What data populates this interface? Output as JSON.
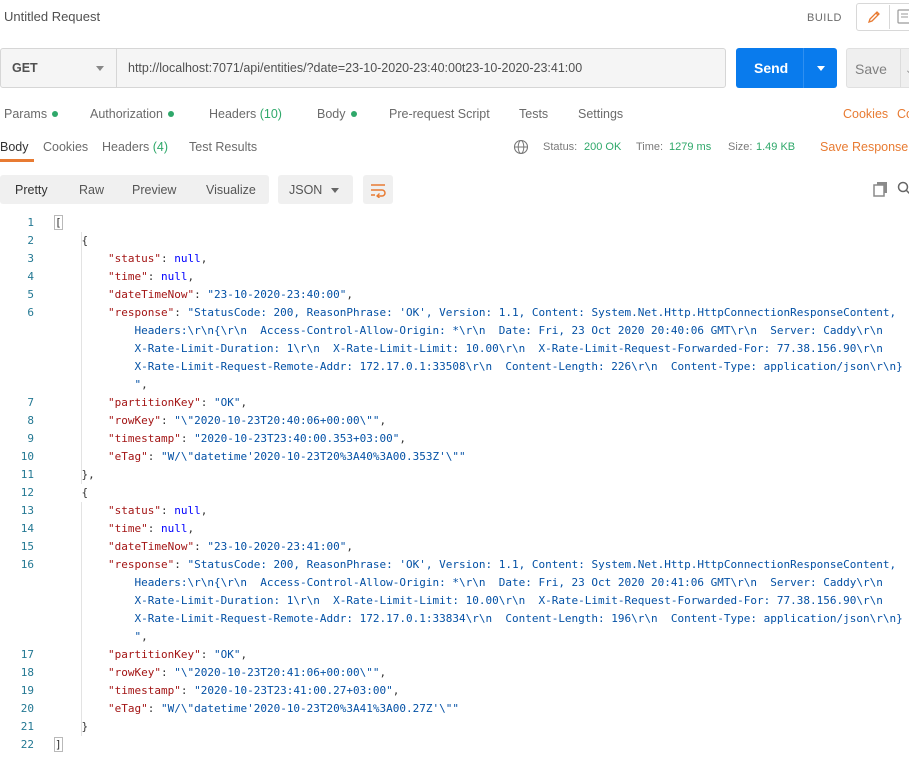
{
  "title": "Untitled Request",
  "header": {
    "build_label": "BUILD"
  },
  "request": {
    "method": "GET",
    "url": "http://localhost:7071/api/entities/?date=23-10-2020-23:40:00t23-10-2020-23:41:00",
    "send_label": "Send",
    "save_label": "Save"
  },
  "request_tabs": {
    "params": "Params",
    "authorization": "Authorization",
    "headers": "Headers",
    "headers_count": "(10)",
    "body": "Body",
    "prerequest": "Pre-request Script",
    "tests": "Tests",
    "settings": "Settings",
    "cookies": "Cookies",
    "code": "Co"
  },
  "response_tabs": {
    "body": "Body",
    "cookies": "Cookies",
    "headers": "Headers",
    "headers_count": "(4)",
    "test_results": "Test Results"
  },
  "status": {
    "status_label": "Status:",
    "status_value": "200 OK",
    "time_label": "Time:",
    "time_value": "1279 ms",
    "size_label": "Size:",
    "size_value": "1.49 KB",
    "save_response": "Save Response"
  },
  "format_bar": {
    "pretty": "Pretty",
    "raw": "Raw",
    "preview": "Preview",
    "visualize": "Visualize",
    "format": "JSON"
  },
  "code_lines": [
    {
      "n": "1",
      "parts": [
        [
          "p",
          "["
        ]
      ]
    },
    {
      "n": "2",
      "parts": [
        [
          "p",
          "    {"
        ]
      ]
    },
    {
      "n": "3",
      "parts": [
        [
          "p",
          "        "
        ],
        [
          "k",
          "\"status\""
        ],
        [
          "p",
          ": "
        ],
        [
          "w",
          "null"
        ],
        [
          "p",
          ","
        ]
      ]
    },
    {
      "n": "4",
      "parts": [
        [
          "p",
          "        "
        ],
        [
          "k",
          "\"time\""
        ],
        [
          "p",
          ": "
        ],
        [
          "w",
          "null"
        ],
        [
          "p",
          ","
        ]
      ]
    },
    {
      "n": "5",
      "parts": [
        [
          "p",
          "        "
        ],
        [
          "k",
          "\"dateTimeNow\""
        ],
        [
          "p",
          ": "
        ],
        [
          "s",
          "\"23-10-2020-23:40:00\""
        ],
        [
          "p",
          ","
        ]
      ]
    },
    {
      "n": "6",
      "parts": [
        [
          "p",
          "        "
        ],
        [
          "k",
          "\"response\""
        ],
        [
          "p",
          ": "
        ],
        [
          "s",
          "\"StatusCode: 200, ReasonPhrase: 'OK', Version: 1.1, Content: System.Net.Http.HttpConnectionResponseContent,"
        ]
      ]
    },
    {
      "n": "",
      "parts": [
        [
          "s",
          "            Headers:\\r\\n{\\r\\n  Access-Control-Allow-Origin: *\\r\\n  Date: Fri, 23 Oct 2020 20:40:06 GMT\\r\\n  Server: Caddy\\r\\n"
        ]
      ]
    },
    {
      "n": "",
      "parts": [
        [
          "s",
          "            X-Rate-Limit-Duration: 1\\r\\n  X-Rate-Limit-Limit: 10.00\\r\\n  X-Rate-Limit-Request-Forwarded-For: 77.38.156.90\\r\\n"
        ]
      ]
    },
    {
      "n": "",
      "parts": [
        [
          "s",
          "            X-Rate-Limit-Request-Remote-Addr: 172.17.0.1:33508\\r\\n  Content-Length: 226\\r\\n  Content-Type: application/json\\r\\n}"
        ]
      ]
    },
    {
      "n": "",
      "parts": [
        [
          "s",
          "            \""
        ],
        [
          "p",
          ","
        ]
      ]
    },
    {
      "n": "7",
      "parts": [
        [
          "p",
          "        "
        ],
        [
          "k",
          "\"partitionKey\""
        ],
        [
          "p",
          ": "
        ],
        [
          "s",
          "\"OK\""
        ],
        [
          "p",
          ","
        ]
      ]
    },
    {
      "n": "8",
      "parts": [
        [
          "p",
          "        "
        ],
        [
          "k",
          "\"rowKey\""
        ],
        [
          "p",
          ": "
        ],
        [
          "s",
          "\"\\\"2020-10-23T20:40:06+00:00\\\"\""
        ],
        [
          "p",
          ","
        ]
      ]
    },
    {
      "n": "9",
      "parts": [
        [
          "p",
          "        "
        ],
        [
          "k",
          "\"timestamp\""
        ],
        [
          "p",
          ": "
        ],
        [
          "s",
          "\"2020-10-23T23:40:00.353+03:00\""
        ],
        [
          "p",
          ","
        ]
      ]
    },
    {
      "n": "10",
      "parts": [
        [
          "p",
          "        "
        ],
        [
          "k",
          "\"eTag\""
        ],
        [
          "p",
          ": "
        ],
        [
          "s",
          "\"W/\\\"datetime'2020-10-23T20%3A40%3A00.353Z'\\\"\""
        ]
      ]
    },
    {
      "n": "11",
      "parts": [
        [
          "p",
          "    },"
        ]
      ]
    },
    {
      "n": "12",
      "parts": [
        [
          "p",
          "    {"
        ]
      ]
    },
    {
      "n": "13",
      "parts": [
        [
          "p",
          "        "
        ],
        [
          "k",
          "\"status\""
        ],
        [
          "p",
          ": "
        ],
        [
          "w",
          "null"
        ],
        [
          "p",
          ","
        ]
      ]
    },
    {
      "n": "14",
      "parts": [
        [
          "p",
          "        "
        ],
        [
          "k",
          "\"time\""
        ],
        [
          "p",
          ": "
        ],
        [
          "w",
          "null"
        ],
        [
          "p",
          ","
        ]
      ]
    },
    {
      "n": "15",
      "parts": [
        [
          "p",
          "        "
        ],
        [
          "k",
          "\"dateTimeNow\""
        ],
        [
          "p",
          ": "
        ],
        [
          "s",
          "\"23-10-2020-23:41:00\""
        ],
        [
          "p",
          ","
        ]
      ]
    },
    {
      "n": "16",
      "parts": [
        [
          "p",
          "        "
        ],
        [
          "k",
          "\"response\""
        ],
        [
          "p",
          ": "
        ],
        [
          "s",
          "\"StatusCode: 200, ReasonPhrase: 'OK', Version: 1.1, Content: System.Net.Http.HttpConnectionResponseContent,"
        ]
      ]
    },
    {
      "n": "",
      "parts": [
        [
          "s",
          "            Headers:\\r\\n{\\r\\n  Access-Control-Allow-Origin: *\\r\\n  Date: Fri, 23 Oct 2020 20:41:06 GMT\\r\\n  Server: Caddy\\r\\n"
        ]
      ]
    },
    {
      "n": "",
      "parts": [
        [
          "s",
          "            X-Rate-Limit-Duration: 1\\r\\n  X-Rate-Limit-Limit: 10.00\\r\\n  X-Rate-Limit-Request-Forwarded-For: 77.38.156.90\\r\\n"
        ]
      ]
    },
    {
      "n": "",
      "parts": [
        [
          "s",
          "            X-Rate-Limit-Request-Remote-Addr: 172.17.0.1:33834\\r\\n  Content-Length: 196\\r\\n  Content-Type: application/json\\r\\n}"
        ]
      ]
    },
    {
      "n": "",
      "parts": [
        [
          "s",
          "            \""
        ],
        [
          "p",
          ","
        ]
      ]
    },
    {
      "n": "17",
      "parts": [
        [
          "p",
          "        "
        ],
        [
          "k",
          "\"partitionKey\""
        ],
        [
          "p",
          ": "
        ],
        [
          "s",
          "\"OK\""
        ],
        [
          "p",
          ","
        ]
      ]
    },
    {
      "n": "18",
      "parts": [
        [
          "p",
          "        "
        ],
        [
          "k",
          "\"rowKey\""
        ],
        [
          "p",
          ": "
        ],
        [
          "s",
          "\"\\\"2020-10-23T20:41:06+00:00\\\"\""
        ],
        [
          "p",
          ","
        ]
      ]
    },
    {
      "n": "19",
      "parts": [
        [
          "p",
          "        "
        ],
        [
          "k",
          "\"timestamp\""
        ],
        [
          "p",
          ": "
        ],
        [
          "s",
          "\"2020-10-23T23:41:00.27+03:00\""
        ],
        [
          "p",
          ","
        ]
      ]
    },
    {
      "n": "20",
      "parts": [
        [
          "p",
          "        "
        ],
        [
          "k",
          "\"eTag\""
        ],
        [
          "p",
          ": "
        ],
        [
          "s",
          "\"W/\\\"datetime'2020-10-23T20%3A41%3A00.27Z'\\\"\""
        ]
      ]
    },
    {
      "n": "21",
      "parts": [
        [
          "p",
          "    }"
        ]
      ]
    },
    {
      "n": "22",
      "parts": [
        [
          "p",
          "]"
        ]
      ]
    }
  ],
  "colors": {
    "accent_orange": "#e87b32",
    "send_blue": "#097bed",
    "status_green": "#2fa86a",
    "json_key": "#a31515",
    "json_string": "#0451a5",
    "json_keyword": "#0000ff",
    "line_number": "#237893"
  },
  "icons": {
    "edit": "pencil-icon",
    "docs": "document-icon",
    "globe": "globe-icon",
    "wrap": "wrap-lines-icon",
    "copy": "copy-icon",
    "search": "search-icon"
  }
}
